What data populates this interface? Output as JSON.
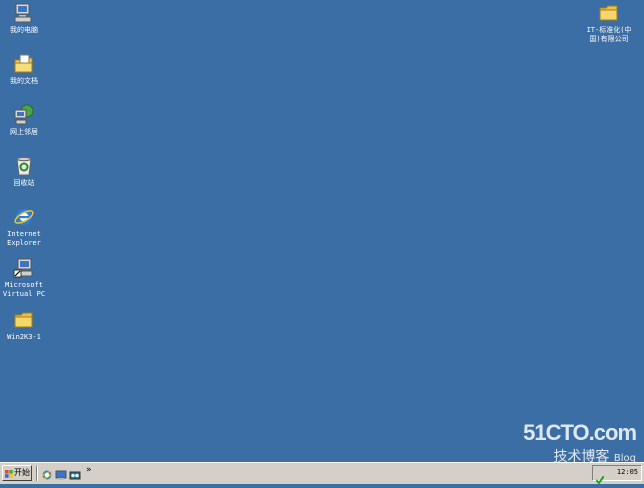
{
  "desktop": {
    "icons": [
      {
        "label": "我的电脑",
        "icon": "my-computer-icon"
      },
      {
        "label": "我的文档",
        "icon": "my-documents-icon"
      },
      {
        "label": "网上邻居",
        "icon": "network-places-icon"
      },
      {
        "label": "回收站",
        "icon": "recycle-bin-icon"
      },
      {
        "label": "Internet\nExplorer",
        "icon": "internet-explorer-icon"
      },
      {
        "label": "Microsoft\nVirtual PC",
        "icon": "virtual-pc-icon"
      },
      {
        "label": "Win2K3-1",
        "icon": "folder-icon"
      },
      {
        "label": "IT-标准化(中\n国)有限公司",
        "icon": "folder-icon"
      }
    ],
    "background_color": "#3a6ea5"
  },
  "taskbar": {
    "start_label": "开始",
    "quick_launch_chevron": "»",
    "clock": "12:05"
  },
  "watermark": {
    "brand": "51CTO.com",
    "subtitle": "技术博客",
    "blog": "Blog"
  }
}
